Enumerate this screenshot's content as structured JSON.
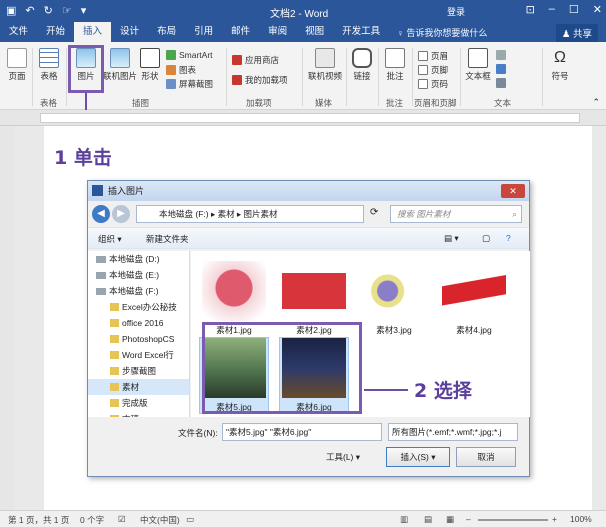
{
  "titlebar": {
    "doc_title": "文档2 - Word",
    "login": "登录"
  },
  "menu": {
    "tabs": [
      "文件",
      "开始",
      "插入",
      "设计",
      "布局",
      "引用",
      "邮件",
      "审阅",
      "视图",
      "开发工具"
    ],
    "active_tab": "插入",
    "tell_me": "告诉我你想要做什么",
    "share": "共享"
  },
  "ribbon": {
    "page": "页面",
    "table": "表格",
    "picture": "图片",
    "online_picture": "联机图片",
    "shapes": "形状",
    "smartart": "SmartArt",
    "chart": "图表",
    "screenshot": "屏幕截图",
    "app_store": "应用商店",
    "my_addins": "我的加载项",
    "online_video": "联机视频",
    "link": "链接",
    "comment": "批注",
    "header": "页眉",
    "footer": "页脚",
    "page_number": "页码",
    "textbox": "文本框",
    "symbol": "符号",
    "groups": {
      "table": "表格",
      "illustrations": "插图",
      "addins": "加载项",
      "media": "媒体",
      "comments": "批注",
      "header_footer": "页眉和页脚",
      "text": "文本"
    }
  },
  "callouts": {
    "step1": "1 单击",
    "step2": "2 选择"
  },
  "dialog": {
    "title": "插入图片",
    "breadcrumb": "本地磁盘 (F:)  ▸  素材  ▸  图片素材",
    "search_placeholder": "搜索 图片素材",
    "organize": "组织 ▾",
    "new_folder": "新建文件夹",
    "tree": [
      {
        "label": "本地磁盘 (D:)",
        "type": "drive"
      },
      {
        "label": "本地磁盘 (E:)",
        "type": "drive"
      },
      {
        "label": "本地磁盘 (F:)",
        "type": "drive"
      },
      {
        "label": "Excel办公秘技",
        "type": "folder"
      },
      {
        "label": "office 2016",
        "type": "folder"
      },
      {
        "label": "PhotoshopCS",
        "type": "folder"
      },
      {
        "label": "Word Excel行",
        "type": "folder"
      },
      {
        "label": "步骤截图",
        "type": "folder"
      },
      {
        "label": "素材",
        "type": "folder"
      },
      {
        "label": "完成版",
        "type": "folder"
      },
      {
        "label": "文稿",
        "type": "folder"
      }
    ],
    "files": [
      {
        "name": "素材1.jpg",
        "color": "#e05a6e"
      },
      {
        "name": "素材2.jpg",
        "color": "#d8343c"
      },
      {
        "name": "素材3.jpg",
        "color": "#8a7ec8"
      },
      {
        "name": "素材4.jpg",
        "color": "#d8242a"
      },
      {
        "name": "素材5.jpg",
        "color": "#4a6e4a"
      },
      {
        "name": "素材6.jpg",
        "color": "#2c3a6a"
      }
    ],
    "filename_label": "文件名(N):",
    "filename_value": "\"素材5.jpg\" \"素材6.jpg\"",
    "filetype_value": "所有图片(*.emf;*.wmf;*.jpg;*.j",
    "tools": "工具(L)  ▾",
    "insert": "插入(S)",
    "cancel": "取消"
  },
  "status": {
    "page": "第 1 页，共 1 页",
    "words": "0 个字",
    "lang": "中文(中国)",
    "zoom": "100%"
  },
  "colors": {
    "accent": "#2b579a",
    "callout": "#5b3f9a"
  }
}
